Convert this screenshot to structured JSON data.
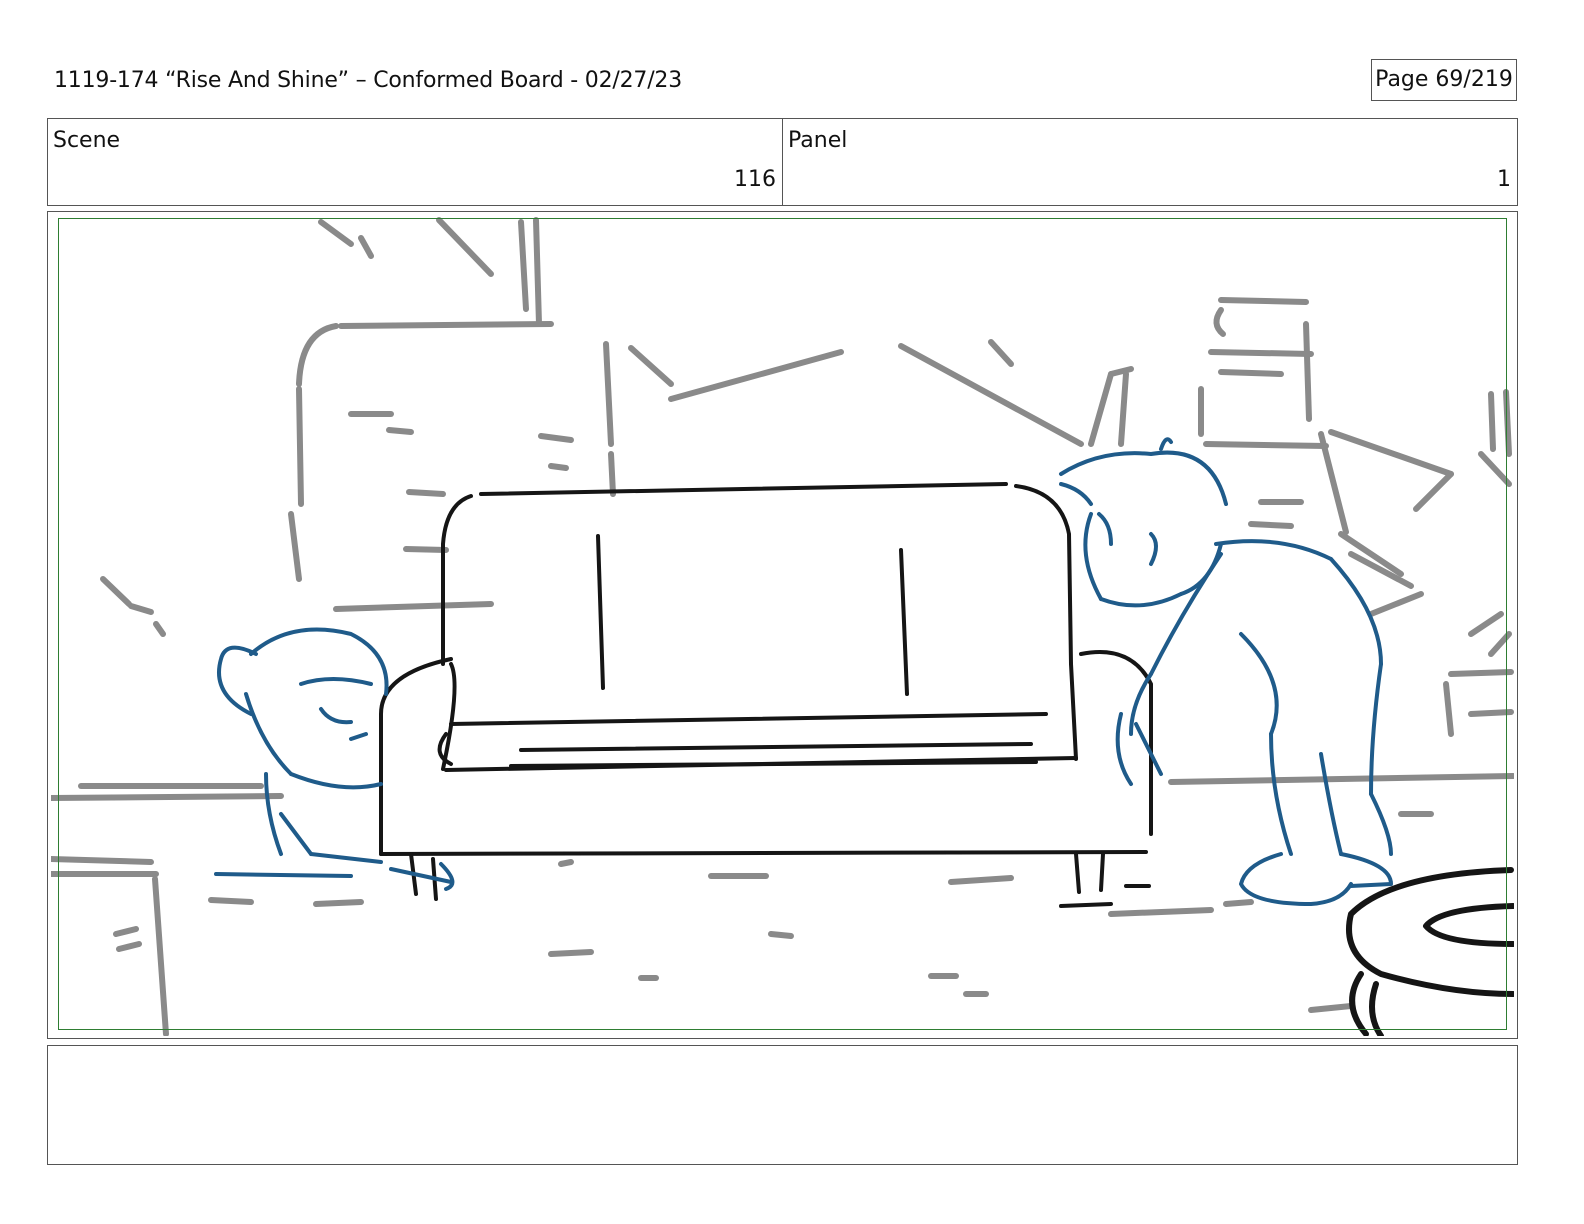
{
  "header": {
    "title": "1119-174 “Rise And Shine” – Conformed Board - 02/27/23",
    "page": "Page  69/219"
  },
  "info": {
    "scene_label": "Scene",
    "scene_value": "116",
    "panel_label": "Panel",
    "panel_value": "1"
  },
  "panel": {
    "frame_color": "#2e7d32",
    "ink_colors": {
      "background": "#8a8a8a",
      "props": "#151515",
      "characters": "#1f5b8a"
    }
  },
  "notes": {
    "text": ""
  }
}
